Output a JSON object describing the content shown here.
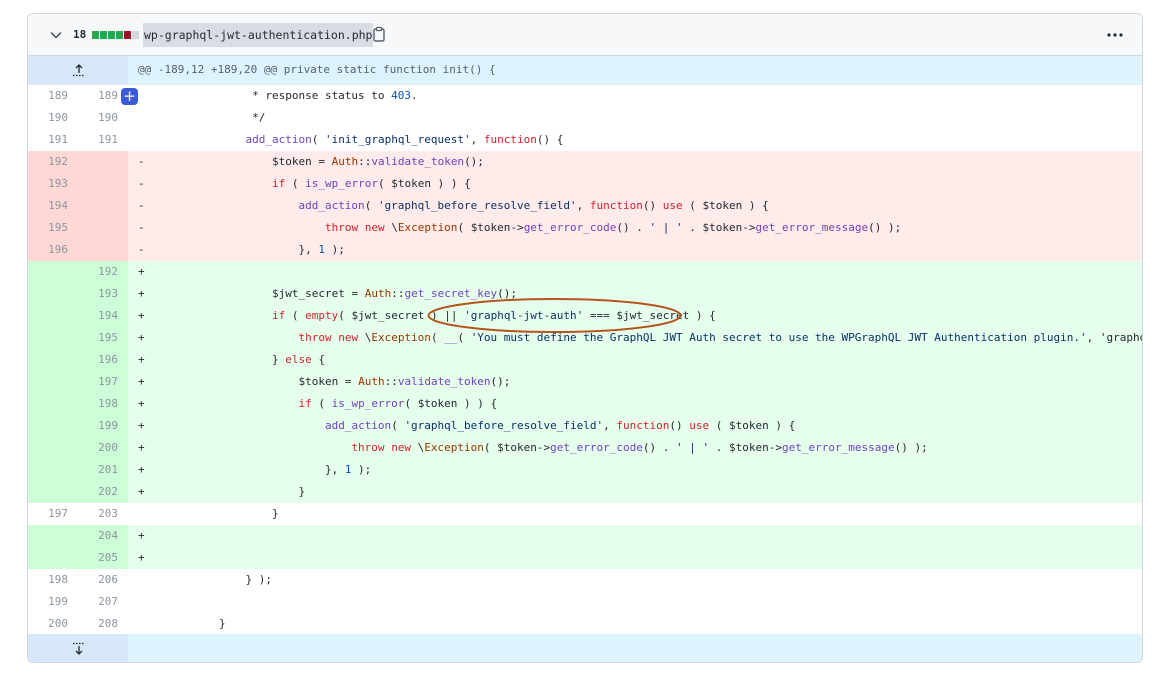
{
  "file": {
    "changes_count": "18",
    "diffstat_colors": [
      "#2da44e",
      "#2da44e",
      "#2da44e",
      "#2da44e",
      "#a40e26",
      "#d0d7de"
    ],
    "filename": "wp-graphql-jwt-authentication.php",
    "icons": {
      "collapse": "chevron-down-icon",
      "copy": "clipboard-icon",
      "menu": "kebab-horizontal-icon"
    }
  },
  "hunk": {
    "header": "@@ -189,12 +189,20 @@ private static function init() {"
  },
  "rows": [
    {
      "type": "ctx",
      "old": "189",
      "new": "189",
      "sign": "",
      "code": "             * response status to 403."
    },
    {
      "type": "ctx",
      "old": "190",
      "new": "190",
      "sign": "",
      "code": "             */"
    },
    {
      "type": "ctx",
      "old": "191",
      "new": "191",
      "sign": "",
      "code": "            add_action( 'init_graphql_request', function() {"
    },
    {
      "type": "del",
      "old": "192",
      "new": "",
      "sign": "-",
      "code": "                $token = Auth::validate_token();"
    },
    {
      "type": "del",
      "old": "193",
      "new": "",
      "sign": "-",
      "code": "                if ( is_wp_error( $token ) ) {"
    },
    {
      "type": "del",
      "old": "194",
      "new": "",
      "sign": "-",
      "code": "                    add_action( 'graphql_before_resolve_field', function() use ( $token ) {"
    },
    {
      "type": "del",
      "old": "195",
      "new": "",
      "sign": "-",
      "code": "                        throw new \\Exception( $token->get_error_code() . ' | ' . $token->get_error_message() );"
    },
    {
      "type": "del",
      "old": "196",
      "new": "",
      "sign": "-",
      "code": "                    }, 1 );"
    },
    {
      "type": "add",
      "old": "",
      "new": "192",
      "sign": "+",
      "code": ""
    },
    {
      "type": "add",
      "old": "",
      "new": "193",
      "sign": "+",
      "code": "                $jwt_secret = Auth::get_secret_key();"
    },
    {
      "type": "add",
      "old": "",
      "new": "194",
      "sign": "+",
      "code": "                if ( empty( $jwt_secret ) || 'graphql-jwt-auth' === $jwt_secret ) {"
    },
    {
      "type": "add",
      "old": "",
      "new": "195",
      "sign": "+",
      "code": "                    throw new \\Exception( __( 'You must define the GraphQL JWT Auth secret to use the WPGraphQL JWT Authentication plugin.', 'graphql-jw"
    },
    {
      "type": "add",
      "old": "",
      "new": "196",
      "sign": "+",
      "code": "                } else {"
    },
    {
      "type": "add",
      "old": "",
      "new": "197",
      "sign": "+",
      "code": "                    $token = Auth::validate_token();"
    },
    {
      "type": "add",
      "old": "",
      "new": "198",
      "sign": "+",
      "code": "                    if ( is_wp_error( $token ) ) {"
    },
    {
      "type": "add",
      "old": "",
      "new": "199",
      "sign": "+",
      "code": "                        add_action( 'graphql_before_resolve_field', function() use ( $token ) {"
    },
    {
      "type": "add",
      "old": "",
      "new": "200",
      "sign": "+",
      "code": "                            throw new \\Exception( $token->get_error_code() . ' | ' . $token->get_error_message() );"
    },
    {
      "type": "add",
      "old": "",
      "new": "201",
      "sign": "+",
      "code": "                        }, 1 );"
    },
    {
      "type": "add",
      "old": "",
      "new": "202",
      "sign": "+",
      "code": "                    }"
    },
    {
      "type": "ctx",
      "old": "197",
      "new": "203",
      "sign": "",
      "code": "                }"
    },
    {
      "type": "add",
      "old": "",
      "new": "204",
      "sign": "+",
      "code": ""
    },
    {
      "type": "add",
      "old": "",
      "new": "205",
      "sign": "+",
      "code": ""
    },
    {
      "type": "ctx",
      "old": "198",
      "new": "206",
      "sign": "",
      "code": "            } );"
    },
    {
      "type": "ctx",
      "old": "199",
      "new": "207",
      "sign": "",
      "code": ""
    },
    {
      "type": "ctx",
      "old": "200",
      "new": "208",
      "sign": "",
      "code": "        }"
    }
  ],
  "colors": {
    "annotation": "#b5541c",
    "add_button": "#3b5bdb"
  }
}
